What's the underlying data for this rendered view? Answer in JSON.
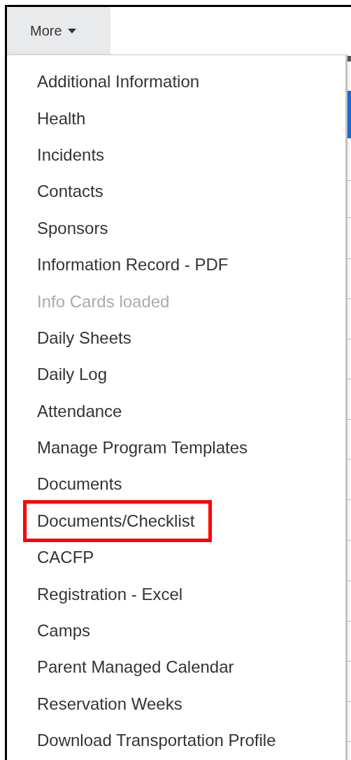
{
  "menu_button": {
    "label": "More",
    "expanded": true
  },
  "menu_items": [
    {
      "label": "Additional Information",
      "disabled": false,
      "highlighted": false
    },
    {
      "label": "Health",
      "disabled": false,
      "highlighted": false
    },
    {
      "label": "Incidents",
      "disabled": false,
      "highlighted": false
    },
    {
      "label": "Contacts",
      "disabled": false,
      "highlighted": false
    },
    {
      "label": "Sponsors",
      "disabled": false,
      "highlighted": false
    },
    {
      "label": "Information Record - PDF",
      "disabled": false,
      "highlighted": false
    },
    {
      "label": "Info Cards loaded",
      "disabled": true,
      "highlighted": false
    },
    {
      "label": "Daily Sheets",
      "disabled": false,
      "highlighted": false
    },
    {
      "label": "Daily Log",
      "disabled": false,
      "highlighted": false
    },
    {
      "label": "Attendance",
      "disabled": false,
      "highlighted": false
    },
    {
      "label": "Manage Program Templates",
      "disabled": false,
      "highlighted": false
    },
    {
      "label": "Documents",
      "disabled": false,
      "highlighted": false
    },
    {
      "label": "Documents/Checklist",
      "disabled": false,
      "highlighted": true
    },
    {
      "label": "CACFP",
      "disabled": false,
      "highlighted": false
    },
    {
      "label": "Registration - Excel",
      "disabled": false,
      "highlighted": false
    },
    {
      "label": "Camps",
      "disabled": false,
      "highlighted": false
    },
    {
      "label": "Parent Managed Calendar",
      "disabled": false,
      "highlighted": false
    },
    {
      "label": "Reservation Weeks",
      "disabled": false,
      "highlighted": false
    },
    {
      "label": "Download Transportation Profile",
      "disabled": false,
      "highlighted": false
    }
  ]
}
